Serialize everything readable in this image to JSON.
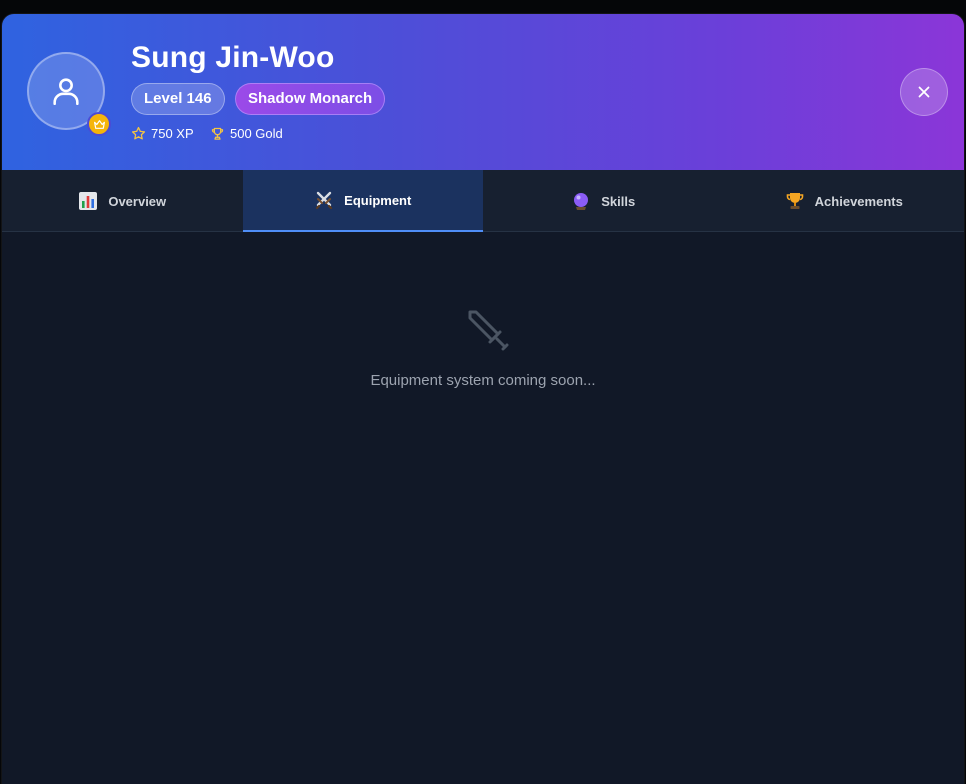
{
  "profile": {
    "name": "Sung Jin-Woo",
    "level_label": "Level 146",
    "title": "Shadow Monarch",
    "xp_label": "750 XP",
    "gold_label": "500 Gold"
  },
  "tabs": [
    {
      "label": "Overview",
      "icon": "bar-chart-icon",
      "active": false
    },
    {
      "label": "Equipment",
      "icon": "crossed-swords-icon",
      "active": true
    },
    {
      "label": "Skills",
      "icon": "crystal-ball-icon",
      "active": false
    },
    {
      "label": "Achievements",
      "icon": "trophy-icon",
      "active": false
    }
  ],
  "equipment": {
    "empty_icon": "sword-icon",
    "empty_message": "Equipment system coming soon..."
  },
  "colors": {
    "header_gradient_start": "#2f63e0",
    "header_gradient_end": "#8b36d8",
    "active_tab_bg": "#1b325f",
    "active_tab_underline": "#4f8ef7",
    "crown_badge": "#f5b50a",
    "content_bg": "#111827"
  }
}
